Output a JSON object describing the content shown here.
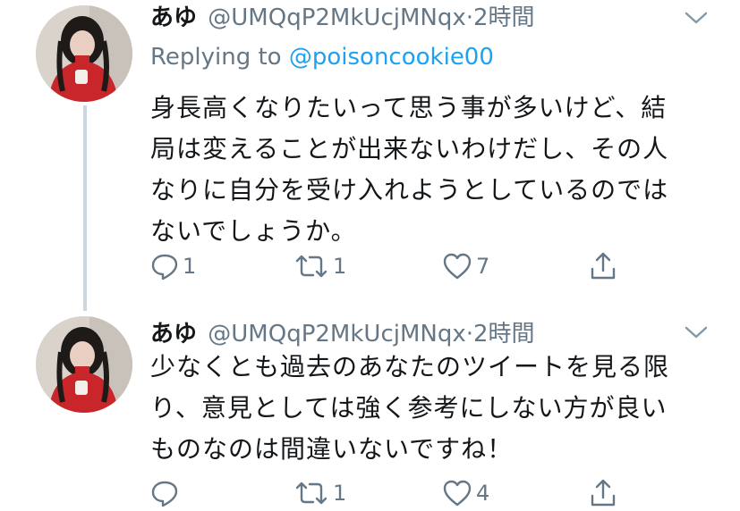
{
  "tweets": [
    {
      "display_name": "あゆ",
      "handle": "@UMQqP2MkUcjMNqx",
      "separator": "·",
      "time": "2時間",
      "replying_prefix": "Replying to",
      "replying_to": "@poisoncookie00",
      "lines": [
        "身長高くなりたいって思う事が多いけど、結",
        "局は変えることが出来ないわけだし、その人",
        "なりに自分を受け入れようとしているのでは",
        "ないでしょうか。"
      ],
      "actions": {
        "reply_icon": "reply-icon",
        "reply_count": "1",
        "retweet_icon": "retweet-icon",
        "retweet_count": "1",
        "like_icon": "heart-icon",
        "like_count": "7",
        "share_icon": "share-icon"
      }
    },
    {
      "display_name": "あゆ",
      "handle": "@UMQqP2MkUcjMNqx",
      "separator": "·",
      "time": "2時間",
      "lines": [
        "少なくとも過去のあなたのツイートを見る限",
        "り、意見としては強く参考にしない方が良い",
        "ものなのは間違いないですね！"
      ],
      "actions": {
        "reply_icon": "reply-icon",
        "reply_count": "",
        "retweet_icon": "retweet-icon",
        "retweet_count": "1",
        "like_icon": "heart-icon",
        "like_count": "4",
        "share_icon": "share-icon"
      }
    }
  ],
  "colors": {
    "text": "#14171a",
    "secondary": "#657786",
    "link": "#1da1f2",
    "thread_line": "#ccd6dd"
  }
}
